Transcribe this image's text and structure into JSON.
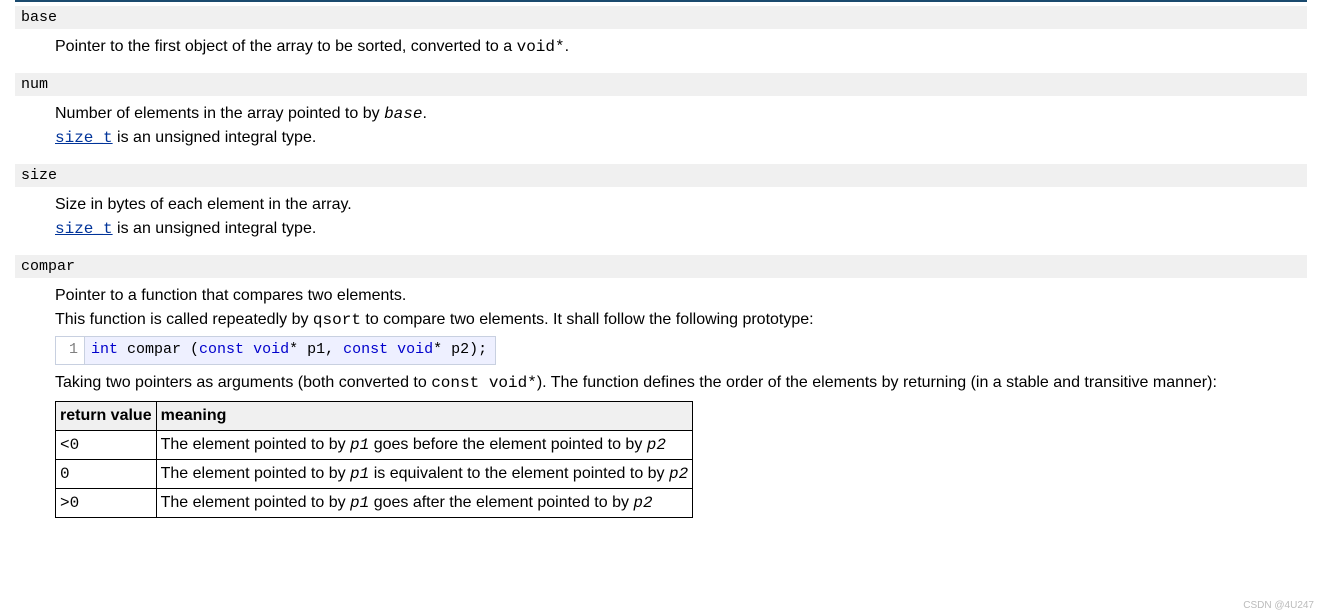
{
  "params": {
    "base": {
      "name": "base",
      "desc_prefix": "Pointer to the first object of the array to be sorted, converted to a ",
      "desc_code": "void*",
      "desc_suffix": "."
    },
    "num": {
      "name": "num",
      "line1_prefix": "Number of elements in the array pointed to by ",
      "line1_em": "base",
      "line1_suffix": ".",
      "type_link": "size_t",
      "type_suffix": " is an unsigned integral type."
    },
    "size": {
      "name": "size",
      "line1": "Size in bytes of each element in the array.",
      "type_link": "size_t",
      "type_suffix": " is an unsigned integral type."
    },
    "compar": {
      "name": "compar",
      "line1": "Pointer to a function that compares two elements.",
      "line2_prefix": "This function is called repeatedly by ",
      "line2_code": "qsort",
      "line2_suffix": " to compare two elements. It shall follow the following prototype:",
      "code_ln": "1",
      "code_kw1": "int",
      "code_t1": " compar (",
      "code_kw2": "const",
      "code_t2": " ",
      "code_kw3": "void",
      "code_t3": "* p1, ",
      "code_kw4": "const",
      "code_t4": " ",
      "code_kw5": "void",
      "code_t5": "* p2);",
      "line3_prefix": "Taking two pointers as arguments (both converted to ",
      "line3_code": "const void*",
      "line3_suffix": "). The function defines the order of the elements by returning (in a stable and transitive manner):",
      "table": {
        "h1": "return value",
        "h2": "meaning",
        "r1c1": "<0",
        "r1_a": "The element pointed to by ",
        "r1_p1": "p1",
        "r1_b": " goes before the element pointed to by ",
        "r1_p2": "p2",
        "r2c1": "0",
        "r2_a": "The element pointed to by ",
        "r2_p1": "p1",
        "r2_b": " is equivalent to the element pointed to by ",
        "r2_p2": "p2",
        "r3c1": ">0",
        "r3_a": "The element pointed to by ",
        "r3_p1": "p1",
        "r3_b": " goes after the element pointed to by ",
        "r3_p2": "p2"
      }
    }
  },
  "watermark": "CSDN @4U247"
}
